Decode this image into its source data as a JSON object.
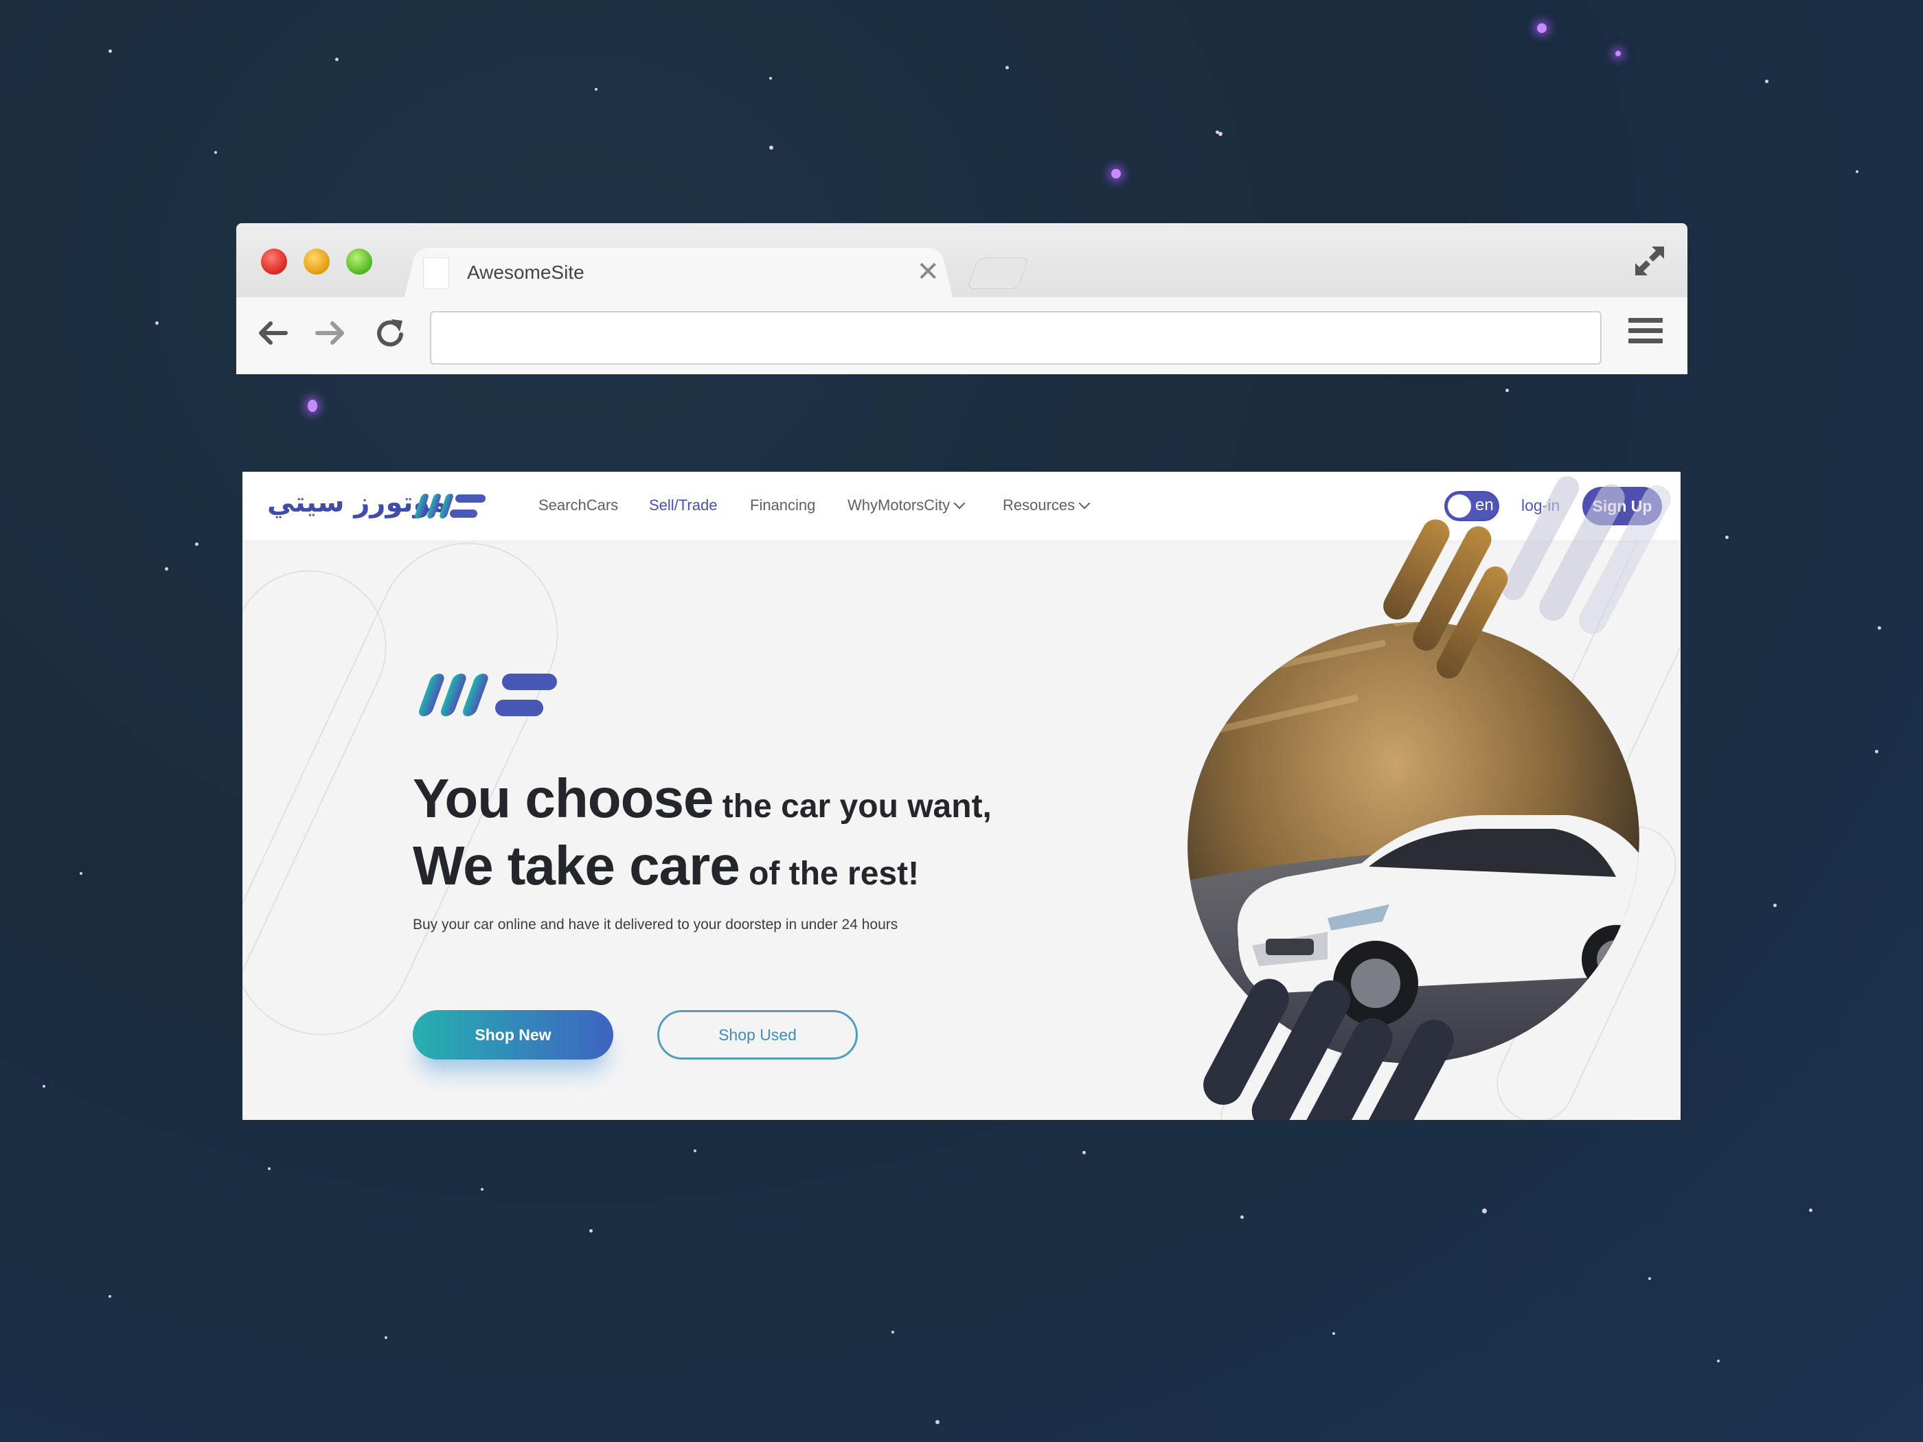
{
  "browser": {
    "tab_title": "AwesomeSite",
    "address_value": ""
  },
  "site": {
    "brand_arabic": "موتورز سيتي",
    "nav": {
      "items": [
        {
          "label": "SearchCars",
          "active": false,
          "dropdown": false
        },
        {
          "label": "Sell/Trade",
          "active": true,
          "dropdown": false
        },
        {
          "label": "Financing",
          "active": false,
          "dropdown": false
        },
        {
          "label": "WhyMotorsCity",
          "active": false,
          "dropdown": true
        },
        {
          "label": "Resources",
          "active": false,
          "dropdown": true
        }
      ],
      "lang_toggle_label": "en",
      "login_label": "log-in",
      "signup_label": "Sign Up"
    },
    "hero": {
      "headline_line1_big": "You choose",
      "headline_line1_small": " the car you want,",
      "headline_line2_big": "We take care",
      "headline_line2_small": " of the rest!",
      "subtext": "Buy your car online and have it delivered to your doorstep in under 24 hours",
      "primary_cta": "Shop New",
      "secondary_cta": "Shop Used"
    },
    "colors": {
      "brand_purple": "#4e4fae",
      "brand_teal": "#26b0b0",
      "brand_blue": "#3e64c2",
      "headline_text": "#25262b"
    }
  }
}
